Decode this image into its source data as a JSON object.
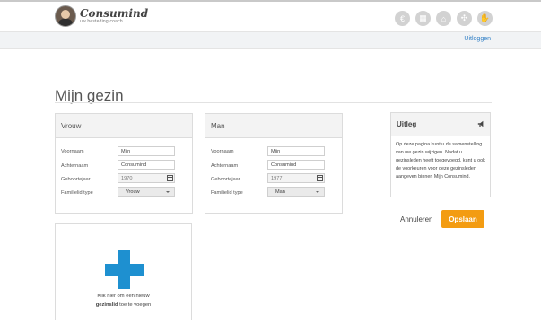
{
  "header": {
    "brand": "Consumind",
    "brand_sub": "uw besteding coach",
    "nav_icons": [
      "money-icon",
      "calendar-icon",
      "cart-icon",
      "tools-icon",
      "handshake-icon"
    ],
    "logout": "Uitloggen"
  },
  "page": {
    "title": "Mijn gezin"
  },
  "members": [
    {
      "heading": "Vrouw",
      "labels": {
        "first": "Voornaam",
        "last": "Achternaam",
        "birth": "Geboortejaar",
        "type": "Familielid type"
      },
      "values": {
        "first": "Mijn",
        "last": "Consumind",
        "birth": "1970",
        "type": "Vrouw"
      }
    },
    {
      "heading": "Man",
      "labels": {
        "first": "Voornaam",
        "last": "Achternaam",
        "birth": "Geboortejaar",
        "type": "Familielid type"
      },
      "values": {
        "first": "Mijn",
        "last": "Consumind",
        "birth": "1977",
        "type": "Man"
      }
    }
  ],
  "uitleg": {
    "heading": "Uitleg",
    "text": "Op deze pagina kunt u de samenstelling van uw gezin wijzigen. Nadat u gezinsleden heeft toegevoegd, kunt u ook de voorkeuren voor deze gezinsleden aangeven binnen Mijn Consumind."
  },
  "actions": {
    "cancel": "Annuleren",
    "save": "Opslaan"
  },
  "add_member": {
    "line1": "Klik hier om een nieuw",
    "bold": "gezinslid",
    "rest": " toe te voegen"
  },
  "colors": {
    "accent": "#f39c12",
    "plus": "#1e90d0",
    "link": "#2f7fc6"
  }
}
